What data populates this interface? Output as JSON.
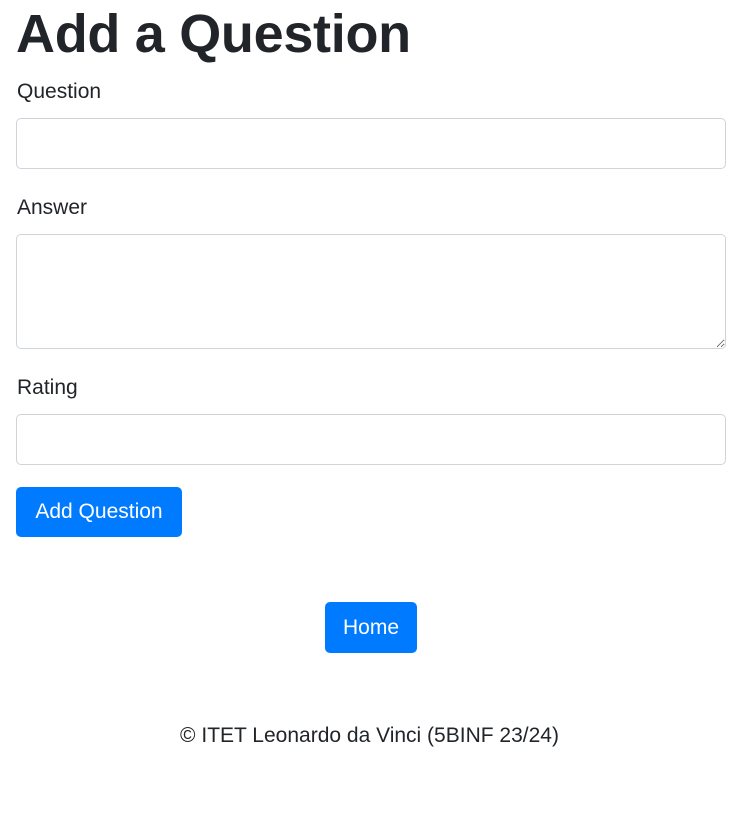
{
  "page": {
    "title": "Add a Question"
  },
  "form": {
    "question": {
      "label": "Question",
      "value": "",
      "placeholder": ""
    },
    "answer": {
      "label": "Answer",
      "value": "",
      "placeholder": ""
    },
    "rating": {
      "label": "Rating",
      "value": "",
      "placeholder": ""
    },
    "submit_label": "Add Question"
  },
  "nav": {
    "home_label": "Home"
  },
  "footer": {
    "text": "© ITET Leonardo da Vinci (5BINF 23/24)"
  },
  "colors": {
    "primary": "#007bff",
    "text": "#212529",
    "input_border": "#ced4da"
  }
}
